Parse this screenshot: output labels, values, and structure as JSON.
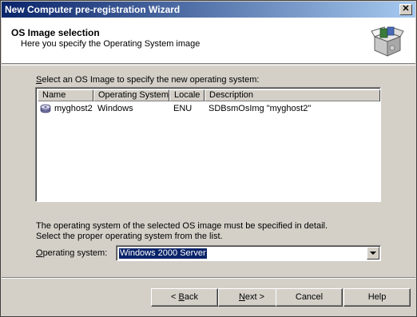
{
  "window": {
    "title": "New Computer pre-registration Wizard",
    "close_glyph": "✕"
  },
  "header": {
    "title": "OS Image selection",
    "subtitle": "Here you specify the Operating System image",
    "icon": "box-package-icon"
  },
  "list": {
    "label": "Select an OS Image to specify the new operating system:",
    "label_access_key": "S",
    "columns": [
      "Name",
      "Operating System",
      "Locale",
      "Description"
    ],
    "rows": [
      {
        "name": "myghost2",
        "os": "Windows",
        "locale": "ENU",
        "description": "SDBsmOsImg \"myghost2\"",
        "icon": "disk-image-icon"
      }
    ]
  },
  "info": {
    "line1": "The operating system of the selected OS image must be specified in detail.",
    "line2": "Select the proper operating system from the list."
  },
  "os_select": {
    "label_access_key": "O",
    "label_rest": "perating system:",
    "value": "Windows 2000 Server"
  },
  "buttons": {
    "back_access_key": "B",
    "back_prefix": "< ",
    "back_rest": "ack",
    "next_access_key": "N",
    "next_rest": "ext >",
    "cancel": "Cancel",
    "help": "Help"
  }
}
